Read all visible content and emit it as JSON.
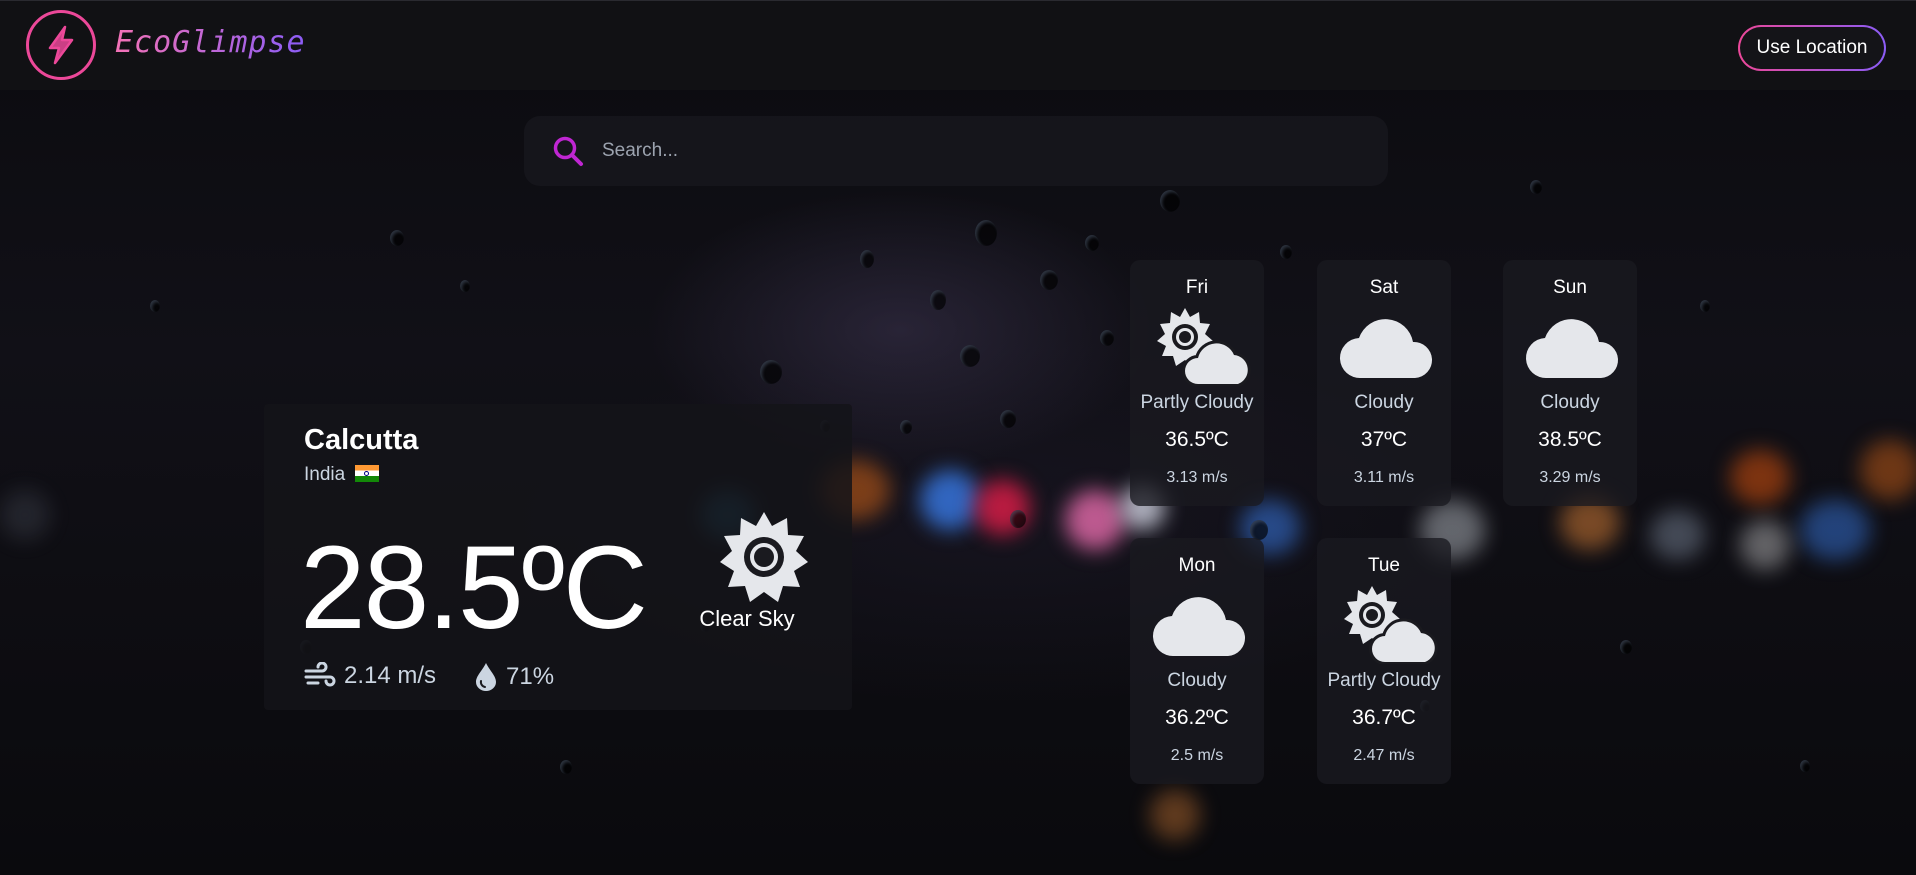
{
  "header": {
    "brand": "EcoGlimpse",
    "use_location_label": "Use Location"
  },
  "search": {
    "placeholder": "Search..."
  },
  "current": {
    "city": "Calcutta",
    "country": "India",
    "temperature": "28.5ºC",
    "condition": "Clear Sky",
    "condition_icon": "sun-icon",
    "wind": "2.14 m/s",
    "humidity": "71%"
  },
  "forecast": [
    {
      "day": "Fri",
      "condition": "Partly Cloudy",
      "icon": "partly-cloudy-icon",
      "temp": "36.5ºC",
      "wind": "3.13 m/s"
    },
    {
      "day": "Sat",
      "condition": "Cloudy",
      "icon": "cloud-icon",
      "temp": "37ºC",
      "wind": "3.11 m/s"
    },
    {
      "day": "Sun",
      "condition": "Cloudy",
      "icon": "cloud-icon",
      "temp": "38.5ºC",
      "wind": "3.29 m/s"
    },
    {
      "day": "Mon",
      "condition": "Cloudy",
      "icon": "cloud-icon",
      "temp": "36.2ºC",
      "wind": "2.5 m/s"
    },
    {
      "day": "Tue",
      "condition": "Partly Cloudy",
      "icon": "partly-cloudy-icon",
      "temp": "36.7ºC",
      "wind": "2.47 m/s"
    }
  ],
  "colors": {
    "accent_pink": "#ec4899",
    "accent_purple": "#8b5cf6",
    "icon_fill": "#e5e7eb"
  }
}
